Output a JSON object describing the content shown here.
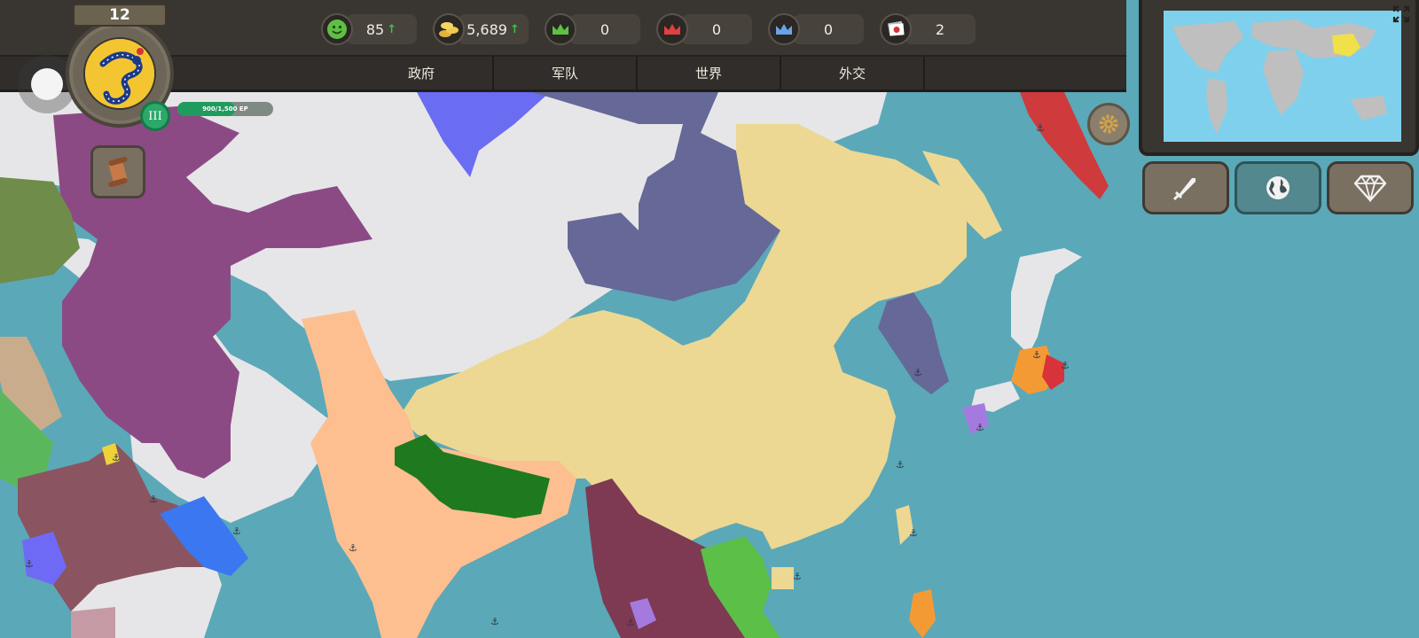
{
  "player": {
    "level": "12",
    "rank": "III",
    "xp_text": "900/1,500 EP",
    "xp_progress": 0.6
  },
  "resources": [
    {
      "icon": "happiness-smiley-icon",
      "value": "85",
      "trend": "↑"
    },
    {
      "icon": "gold-coins-icon",
      "value": "5,689",
      "trend": "↑"
    },
    {
      "icon": "green-crown-icon",
      "value": "0",
      "trend": ""
    },
    {
      "icon": "red-crown-icon",
      "value": "0",
      "trend": ""
    },
    {
      "icon": "blue-crown-icon",
      "value": "0",
      "trend": ""
    },
    {
      "icon": "japan-flag-card-icon",
      "value": "2",
      "trend": ""
    }
  ],
  "tabs": [
    "政府",
    "军队",
    "世界",
    "外交"
  ],
  "action_buttons": [
    {
      "icon": "sword-icon"
    },
    {
      "icon": "globe-icon"
    },
    {
      "icon": "diamond-icon"
    }
  ],
  "colors": {
    "ocean": "#5ba8b8",
    "china": "#ecd893",
    "unclaimed": "#e6e6e8",
    "mongolia": "#666897",
    "russia": "#e6e6e8",
    "india": "#fdbf90",
    "nepal": "#1f7a1f",
    "persia": "#8c4a85",
    "accent_green": "#2ba86a"
  }
}
